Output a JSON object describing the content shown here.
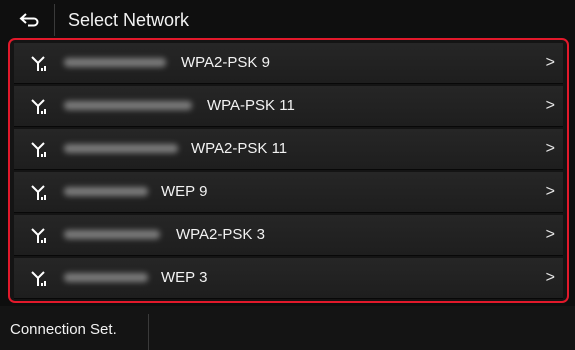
{
  "header": {
    "title": "Select Network",
    "back_icon": "back-arrow-icon"
  },
  "networks": [
    {
      "security": "WPA2-PSK 9"
    },
    {
      "security": "WPA-PSK 11"
    },
    {
      "security": "WPA2-PSK 11"
    },
    {
      "security": "WEP 9"
    },
    {
      "security": "WPA2-PSK 3"
    },
    {
      "security": "WEP 3"
    }
  ],
  "row_icon": "wifi-antenna-icon",
  "row_chevron": ">",
  "footer": {
    "connection_settings_label": "Connection Set."
  },
  "colors": {
    "background": "#0e0e0e",
    "row": "#232323",
    "highlight_border": "#e2192b",
    "text": "#f2f2f2"
  }
}
